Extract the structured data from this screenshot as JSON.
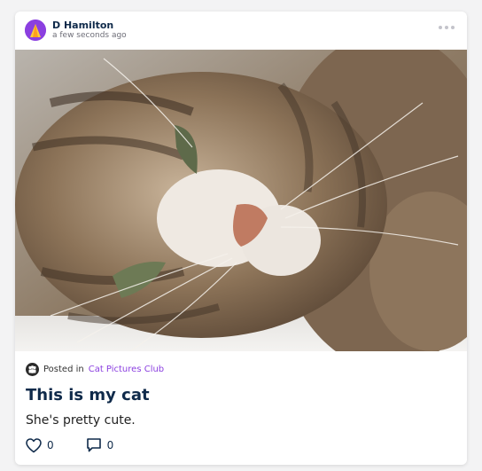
{
  "post": {
    "author": "D Hamilton",
    "timestamp": "a few seconds ago",
    "image_alt": "Tabby cat lying on its side",
    "posted_in_prefix": "Posted in",
    "group_name": "Cat Pictures Club",
    "title": "This is my cat",
    "body": "She's pretty cute.",
    "likes": "0",
    "comments": "0"
  },
  "icons": {
    "avatar": "user-avatar-icon",
    "more": "more-options-icon",
    "group": "group-icon",
    "like": "heart-icon",
    "comment": "comment-icon"
  },
  "colors": {
    "accent": "#8b3fe0",
    "title": "#0f2a4a",
    "background": "#f3f3f4"
  }
}
